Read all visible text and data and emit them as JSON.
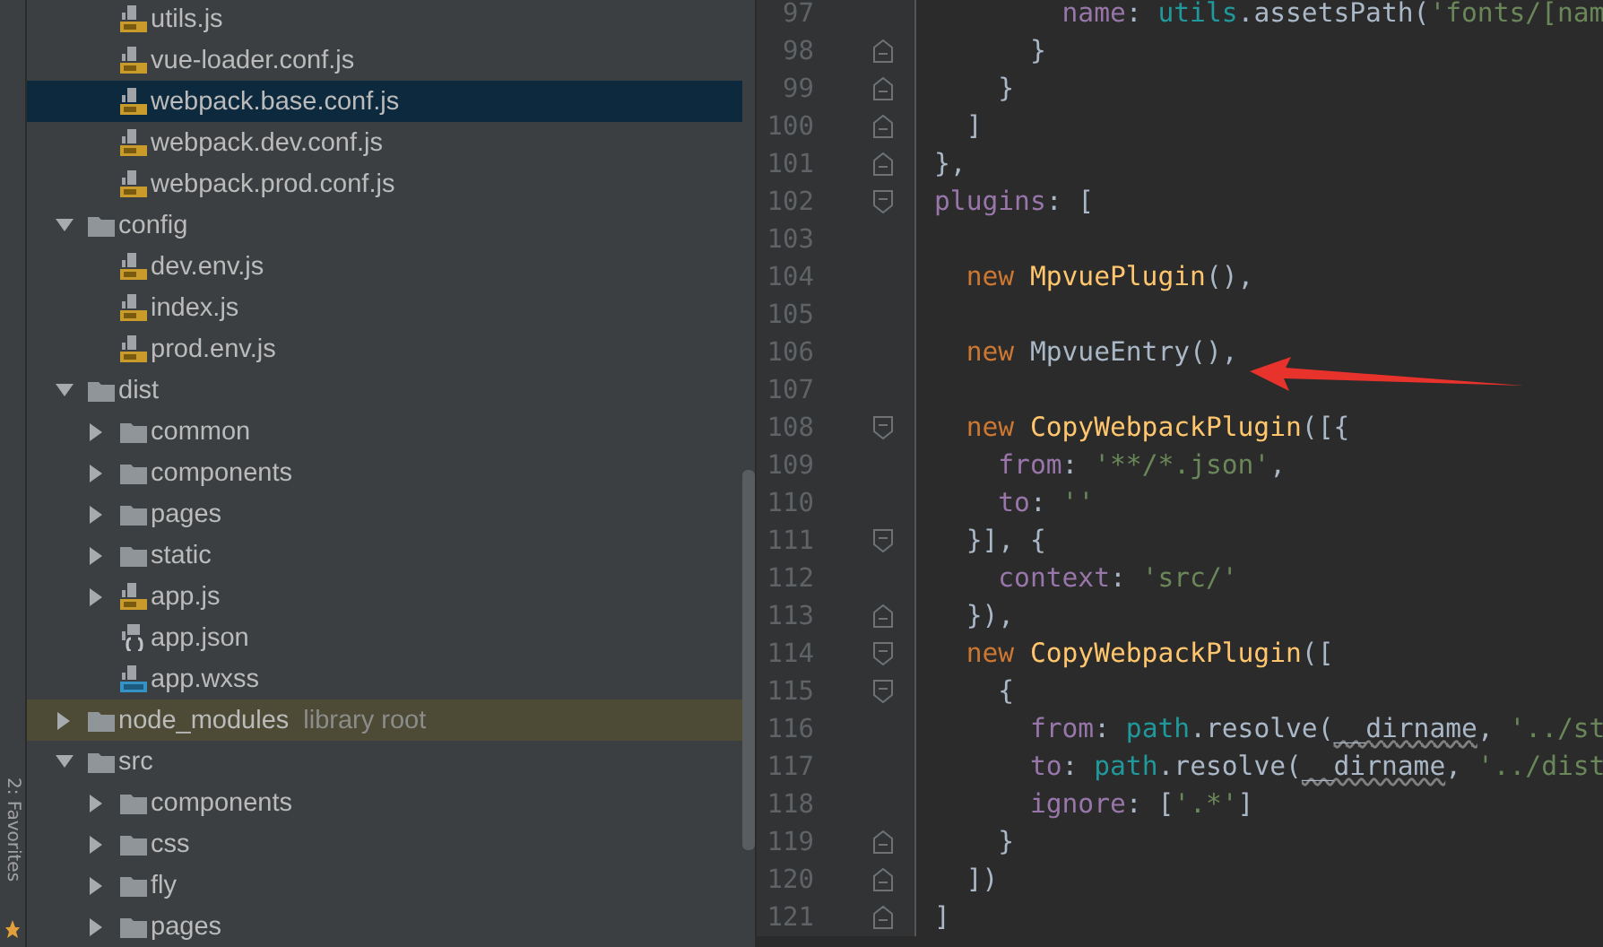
{
  "tool_strip": {
    "label": "2: Favorites"
  },
  "project_tree": {
    "continued_items": [
      {
        "name": "utils.js",
        "kind": "js",
        "selected": false
      },
      {
        "name": "vue-loader.conf.js",
        "kind": "js",
        "selected": false
      },
      {
        "name": "webpack.base.conf.js",
        "kind": "js",
        "selected": true
      },
      {
        "name": "webpack.dev.conf.js",
        "kind": "js",
        "selected": false
      },
      {
        "name": "webpack.prod.conf.js",
        "kind": "js",
        "selected": false
      }
    ],
    "items": [
      {
        "name": "config",
        "kind": "folder",
        "expanded": true,
        "selected": false,
        "children": [
          {
            "name": "dev.env.js",
            "kind": "js",
            "selected": false
          },
          {
            "name": "index.js",
            "kind": "js",
            "selected": false
          },
          {
            "name": "prod.env.js",
            "kind": "js",
            "selected": false
          }
        ]
      },
      {
        "name": "dist",
        "kind": "folder",
        "expanded": true,
        "selected": false,
        "children": [
          {
            "name": "common",
            "kind": "folder",
            "expanded": false,
            "selected": false
          },
          {
            "name": "components",
            "kind": "folder",
            "expanded": false,
            "selected": false
          },
          {
            "name": "pages",
            "kind": "folder",
            "expanded": false,
            "selected": false
          },
          {
            "name": "static",
            "kind": "folder",
            "expanded": false,
            "selected": false
          },
          {
            "name": "app.js",
            "kind": "js",
            "expanded": false,
            "selected": false
          },
          {
            "name": "app.json",
            "kind": "json",
            "selected": false
          },
          {
            "name": "app.wxss",
            "kind": "css",
            "selected": false
          }
        ]
      },
      {
        "name": "node_modules",
        "kind": "folder",
        "expanded": false,
        "selected": false,
        "library": true,
        "hint": "library root"
      },
      {
        "name": "src",
        "kind": "folder",
        "expanded": true,
        "selected": false,
        "children": [
          {
            "name": "components",
            "kind": "folder",
            "expanded": false,
            "selected": false
          },
          {
            "name": "css",
            "kind": "folder",
            "expanded": false,
            "selected": false
          },
          {
            "name": "fly",
            "kind": "folder",
            "expanded": false,
            "selected": false
          },
          {
            "name": "pages",
            "kind": "folder",
            "expanded": false,
            "selected": false
          }
        ]
      }
    ]
  },
  "editor": {
    "lines": [
      {
        "number": "97",
        "tokens": [
          {
            "kind": "prop",
            "text": "        name"
          },
          {
            "kind": "plain",
            "text": ": "
          },
          {
            "kind": "ident",
            "text": "utils"
          },
          {
            "kind": "plain",
            "text": ".assetsPath("
          },
          {
            "kind": "str",
            "text": "'fonts/[nam"
          }
        ]
      },
      {
        "number": "98",
        "fold_marker": {
          "kind": "end"
        },
        "tokens": [
          {
            "kind": "plain",
            "text": "      }"
          }
        ]
      },
      {
        "number": "99",
        "fold_marker": {
          "kind": "end"
        },
        "tokens": [
          {
            "kind": "plain",
            "text": "    }"
          }
        ]
      },
      {
        "number": "100",
        "fold_marker": {
          "kind": "end"
        },
        "tokens": [
          {
            "kind": "plain",
            "text": "  ]"
          }
        ]
      },
      {
        "number": "101",
        "fold_marker": {
          "kind": "end"
        },
        "tokens": [
          {
            "kind": "plain",
            "text": "},"
          }
        ]
      },
      {
        "number": "102",
        "fold_marker": {
          "kind": "start"
        },
        "tokens": [
          {
            "kind": "prop",
            "text": "plugins"
          },
          {
            "kind": "plain",
            "text": ": ["
          }
        ]
      },
      {
        "number": "103"
      },
      {
        "number": "104",
        "tokens": [
          {
            "kind": "kw",
            "text": "  new "
          },
          {
            "kind": "cls",
            "text": "MpvuePlugin"
          },
          {
            "kind": "plain",
            "text": "(),"
          }
        ]
      },
      {
        "number": "105"
      },
      {
        "number": "106",
        "tokens": [
          {
            "kind": "kw",
            "text": "  new "
          },
          {
            "kind": "plain",
            "text": "MpvueEntry(),"
          }
        ]
      },
      {
        "number": "107"
      },
      {
        "number": "108",
        "fold_marker": {
          "kind": "start"
        },
        "tokens": [
          {
            "kind": "kw",
            "text": "  new "
          },
          {
            "kind": "cls",
            "text": "CopyWebpackPlugin"
          },
          {
            "kind": "plain",
            "text": "([{"
          }
        ]
      },
      {
        "number": "109",
        "tokens": [
          {
            "kind": "prop",
            "text": "    from"
          },
          {
            "kind": "plain",
            "text": ": "
          },
          {
            "kind": "str",
            "text": "'**/*.json'"
          },
          {
            "kind": "plain",
            "text": ","
          }
        ]
      },
      {
        "number": "110",
        "tokens": [
          {
            "kind": "prop",
            "text": "    to"
          },
          {
            "kind": "plain",
            "text": ": "
          },
          {
            "kind": "str",
            "text": "''"
          }
        ]
      },
      {
        "number": "111",
        "fold_marker": {
          "kind": "start"
        },
        "tokens": [
          {
            "kind": "plain",
            "text": "  }], {"
          }
        ]
      },
      {
        "number": "112",
        "tokens": [
          {
            "kind": "prop",
            "text": "    context"
          },
          {
            "kind": "plain",
            "text": ": "
          },
          {
            "kind": "str",
            "text": "'src/'"
          }
        ]
      },
      {
        "number": "113",
        "fold_marker": {
          "kind": "end"
        },
        "tokens": [
          {
            "kind": "plain",
            "text": "  }),"
          }
        ]
      },
      {
        "number": "114",
        "fold_marker": {
          "kind": "start"
        },
        "tokens": [
          {
            "kind": "kw",
            "text": "  new "
          },
          {
            "kind": "cls",
            "text": "CopyWebpackPlugin"
          },
          {
            "kind": "plain",
            "text": "(["
          }
        ]
      },
      {
        "number": "115",
        "fold_marker": {
          "kind": "start"
        },
        "tokens": [
          {
            "kind": "plain",
            "text": "    {"
          }
        ]
      },
      {
        "number": "116",
        "tokens": [
          {
            "kind": "prop",
            "text": "      from"
          },
          {
            "kind": "plain",
            "text": ": "
          },
          {
            "kind": "ident",
            "text": "path"
          },
          {
            "kind": "plain",
            "text": ".resolve("
          },
          {
            "kind": "warn",
            "text": "__dirname"
          },
          {
            "kind": "plain",
            "text": ", "
          },
          {
            "kind": "str",
            "text": "'../st"
          }
        ]
      },
      {
        "number": "117",
        "tokens": [
          {
            "kind": "prop",
            "text": "      to"
          },
          {
            "kind": "plain",
            "text": ": "
          },
          {
            "kind": "ident",
            "text": "path"
          },
          {
            "kind": "plain",
            "text": ".resolve("
          },
          {
            "kind": "warn",
            "text": "__dirname"
          },
          {
            "kind": "plain",
            "text": ", "
          },
          {
            "kind": "str",
            "text": "'../dist"
          }
        ]
      },
      {
        "number": "118",
        "tokens": [
          {
            "kind": "prop",
            "text": "      ignore"
          },
          {
            "kind": "plain",
            "text": ": ["
          },
          {
            "kind": "str",
            "text": "'.*'"
          },
          {
            "kind": "plain",
            "text": "]"
          }
        ]
      },
      {
        "number": "119",
        "fold_marker": {
          "kind": "end"
        },
        "tokens": [
          {
            "kind": "plain",
            "text": "    }"
          }
        ]
      },
      {
        "number": "120",
        "fold_marker": {
          "kind": "end"
        },
        "tokens": [
          {
            "kind": "plain",
            "text": "  ])"
          }
        ]
      },
      {
        "number": "121",
        "fold_marker": {
          "kind": "end"
        },
        "tokens": [
          {
            "kind": "plain",
            "text": "]"
          }
        ]
      }
    ]
  }
}
